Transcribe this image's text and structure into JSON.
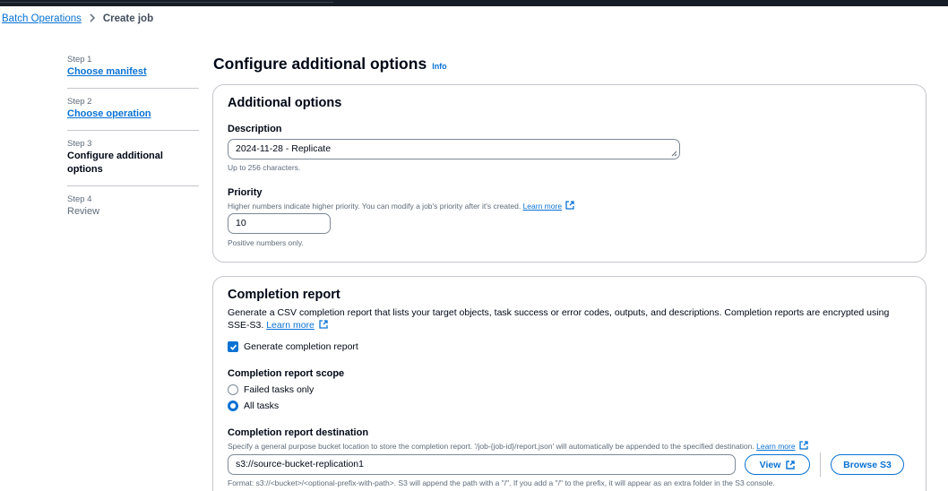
{
  "breadcrumb": {
    "parent": "Batch Operations",
    "current": "Create job"
  },
  "steps": [
    {
      "num": "Step 1",
      "title": "Choose manifest",
      "state": "link"
    },
    {
      "num": "Step 2",
      "title": "Choose operation",
      "state": "link"
    },
    {
      "num": "Step 3",
      "title": "Configure additional options",
      "state": "active"
    },
    {
      "num": "Step 4",
      "title": "Review",
      "state": "disabled"
    }
  ],
  "page": {
    "title": "Configure additional options",
    "info": "Info"
  },
  "additional_options": {
    "title": "Additional options",
    "description_label": "Description",
    "description_value": "2024-11-28 - Replicate",
    "description_hint": "Up to 256 characters.",
    "priority_label": "Priority",
    "priority_desc": "Higher numbers indicate higher priority. You can modify a job's priority after it's created.",
    "priority_learn_more": "Learn more",
    "priority_value": "10",
    "priority_hint": "Positive numbers only."
  },
  "completion_report": {
    "title": "Completion report",
    "desc_line1": "Generate a CSV completion report that lists your target objects, task success or error codes, outputs, and descriptions. Completion reports are encrypted using",
    "desc_line2": "SSE-S3.",
    "learn_more": "Learn more",
    "generate_label": "Generate completion report",
    "generate_checked": true,
    "scope_label": "Completion report scope",
    "scope_options": [
      "Failed tasks only",
      "All tasks"
    ],
    "scope_selected": "All tasks",
    "destination_label": "Completion report destination",
    "destination_desc": "Specify a general purpose bucket location to store the completion report. '/job-{job-id}/report.json' will automatically be appended to the specified destination.",
    "destination_learn_more": "Learn more",
    "destination_value": "s3://source-bucket-replication1",
    "view_button": "View",
    "browse_button": "Browse S3",
    "format_hint": "Format: s3://<bucket>/<optional-prefix-with-path>. S3 will append the path with a \"/\". If you add a \"/\" to the prefix, it will appear as an extra folder in the S3 console."
  },
  "colors": {
    "link": "#0972d3",
    "text": "#000716",
    "muted": "#5f6b7a",
    "border": "#c6c6cd",
    "topbar": "#161d26"
  }
}
